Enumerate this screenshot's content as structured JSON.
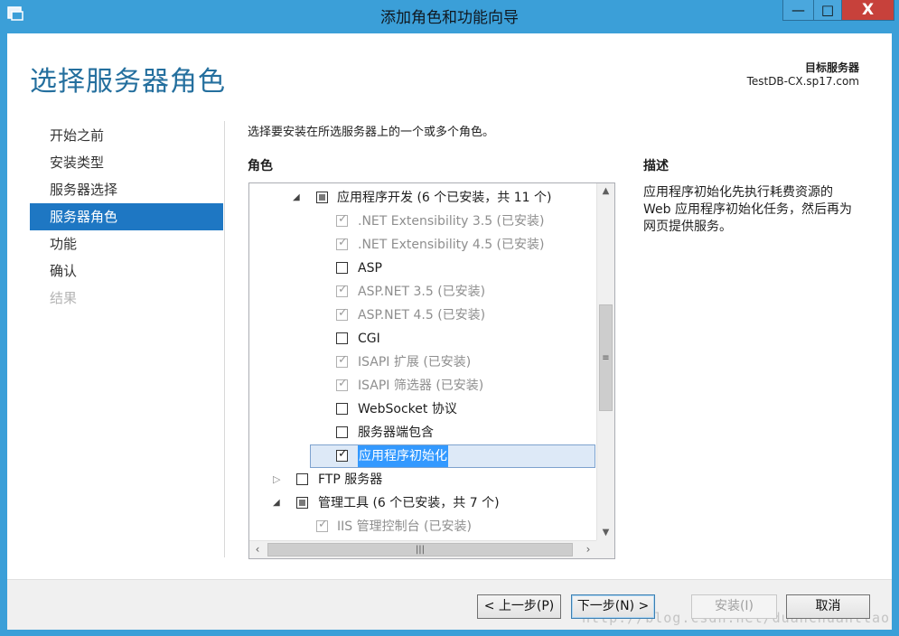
{
  "window": {
    "title": "添加角色和功能向导",
    "minimize": "—",
    "maximize": "□",
    "close": "X"
  },
  "header": {
    "page_title": "选择服务器角色",
    "target_label": "目标服务器",
    "target_value": "TestDB-CX.sp17.com"
  },
  "nav": {
    "items": [
      {
        "label": "开始之前",
        "state": "normal"
      },
      {
        "label": "安装类型",
        "state": "normal"
      },
      {
        "label": "服务器选择",
        "state": "normal"
      },
      {
        "label": "服务器角色",
        "state": "active"
      },
      {
        "label": "功能",
        "state": "normal"
      },
      {
        "label": "确认",
        "state": "normal"
      },
      {
        "label": "结果",
        "state": "disabled"
      }
    ]
  },
  "main": {
    "instruction": "选择要安装在所选服务器上的一个或多个角色。",
    "roles_header": "角色",
    "description_header": "描述",
    "description_text": "应用程序初始化先执行耗费资源的 Web 应用程序初始化任务，然后再为网页提供服务。",
    "tree": [
      {
        "label": "应用程序开发 (6 个已安装，共 11 个)",
        "level": 1,
        "expander": "expanded",
        "check": "partial",
        "disabled": false
      },
      {
        "label": ".NET Extensibility 3.5 (已安装)",
        "level": 2,
        "check": "checked",
        "disabled": true
      },
      {
        "label": ".NET Extensibility 4.5 (已安装)",
        "level": 2,
        "check": "checked",
        "disabled": true
      },
      {
        "label": "ASP",
        "level": 2,
        "check": "unchecked",
        "disabled": false
      },
      {
        "label": "ASP.NET 3.5 (已安装)",
        "level": 2,
        "check": "checked",
        "disabled": true
      },
      {
        "label": "ASP.NET 4.5 (已安装)",
        "level": 2,
        "check": "checked",
        "disabled": true
      },
      {
        "label": "CGI",
        "level": 2,
        "check": "unchecked",
        "disabled": false
      },
      {
        "label": "ISAPI 扩展 (已安装)",
        "level": 2,
        "check": "checked",
        "disabled": true
      },
      {
        "label": "ISAPI 筛选器 (已安装)",
        "level": 2,
        "check": "checked",
        "disabled": true
      },
      {
        "label": "WebSocket 协议",
        "level": 2,
        "check": "unchecked",
        "disabled": false
      },
      {
        "label": "服务器端包含",
        "level": 2,
        "check": "unchecked",
        "disabled": false
      },
      {
        "label": "应用程序初始化",
        "level": 2,
        "check": "checked",
        "disabled": false,
        "selected": true
      },
      {
        "label": "FTP 服务器",
        "level": 0,
        "expander": "collapsed",
        "check": "unchecked",
        "disabled": false
      },
      {
        "label": "管理工具 (6 个已安装，共 7 个)",
        "level": 0,
        "expander": "expanded",
        "check": "partial",
        "disabled": false
      },
      {
        "label": "IIS 管理控制台 (已安装)",
        "level": 1,
        "check": "checked",
        "disabled": true
      }
    ]
  },
  "footer": {
    "prev": "< 上一步(P)",
    "next": "下一步(N) >",
    "install": "安装(I)",
    "cancel": "取消",
    "watermark": "http://blog.csdn.net/duanchuanttao"
  }
}
